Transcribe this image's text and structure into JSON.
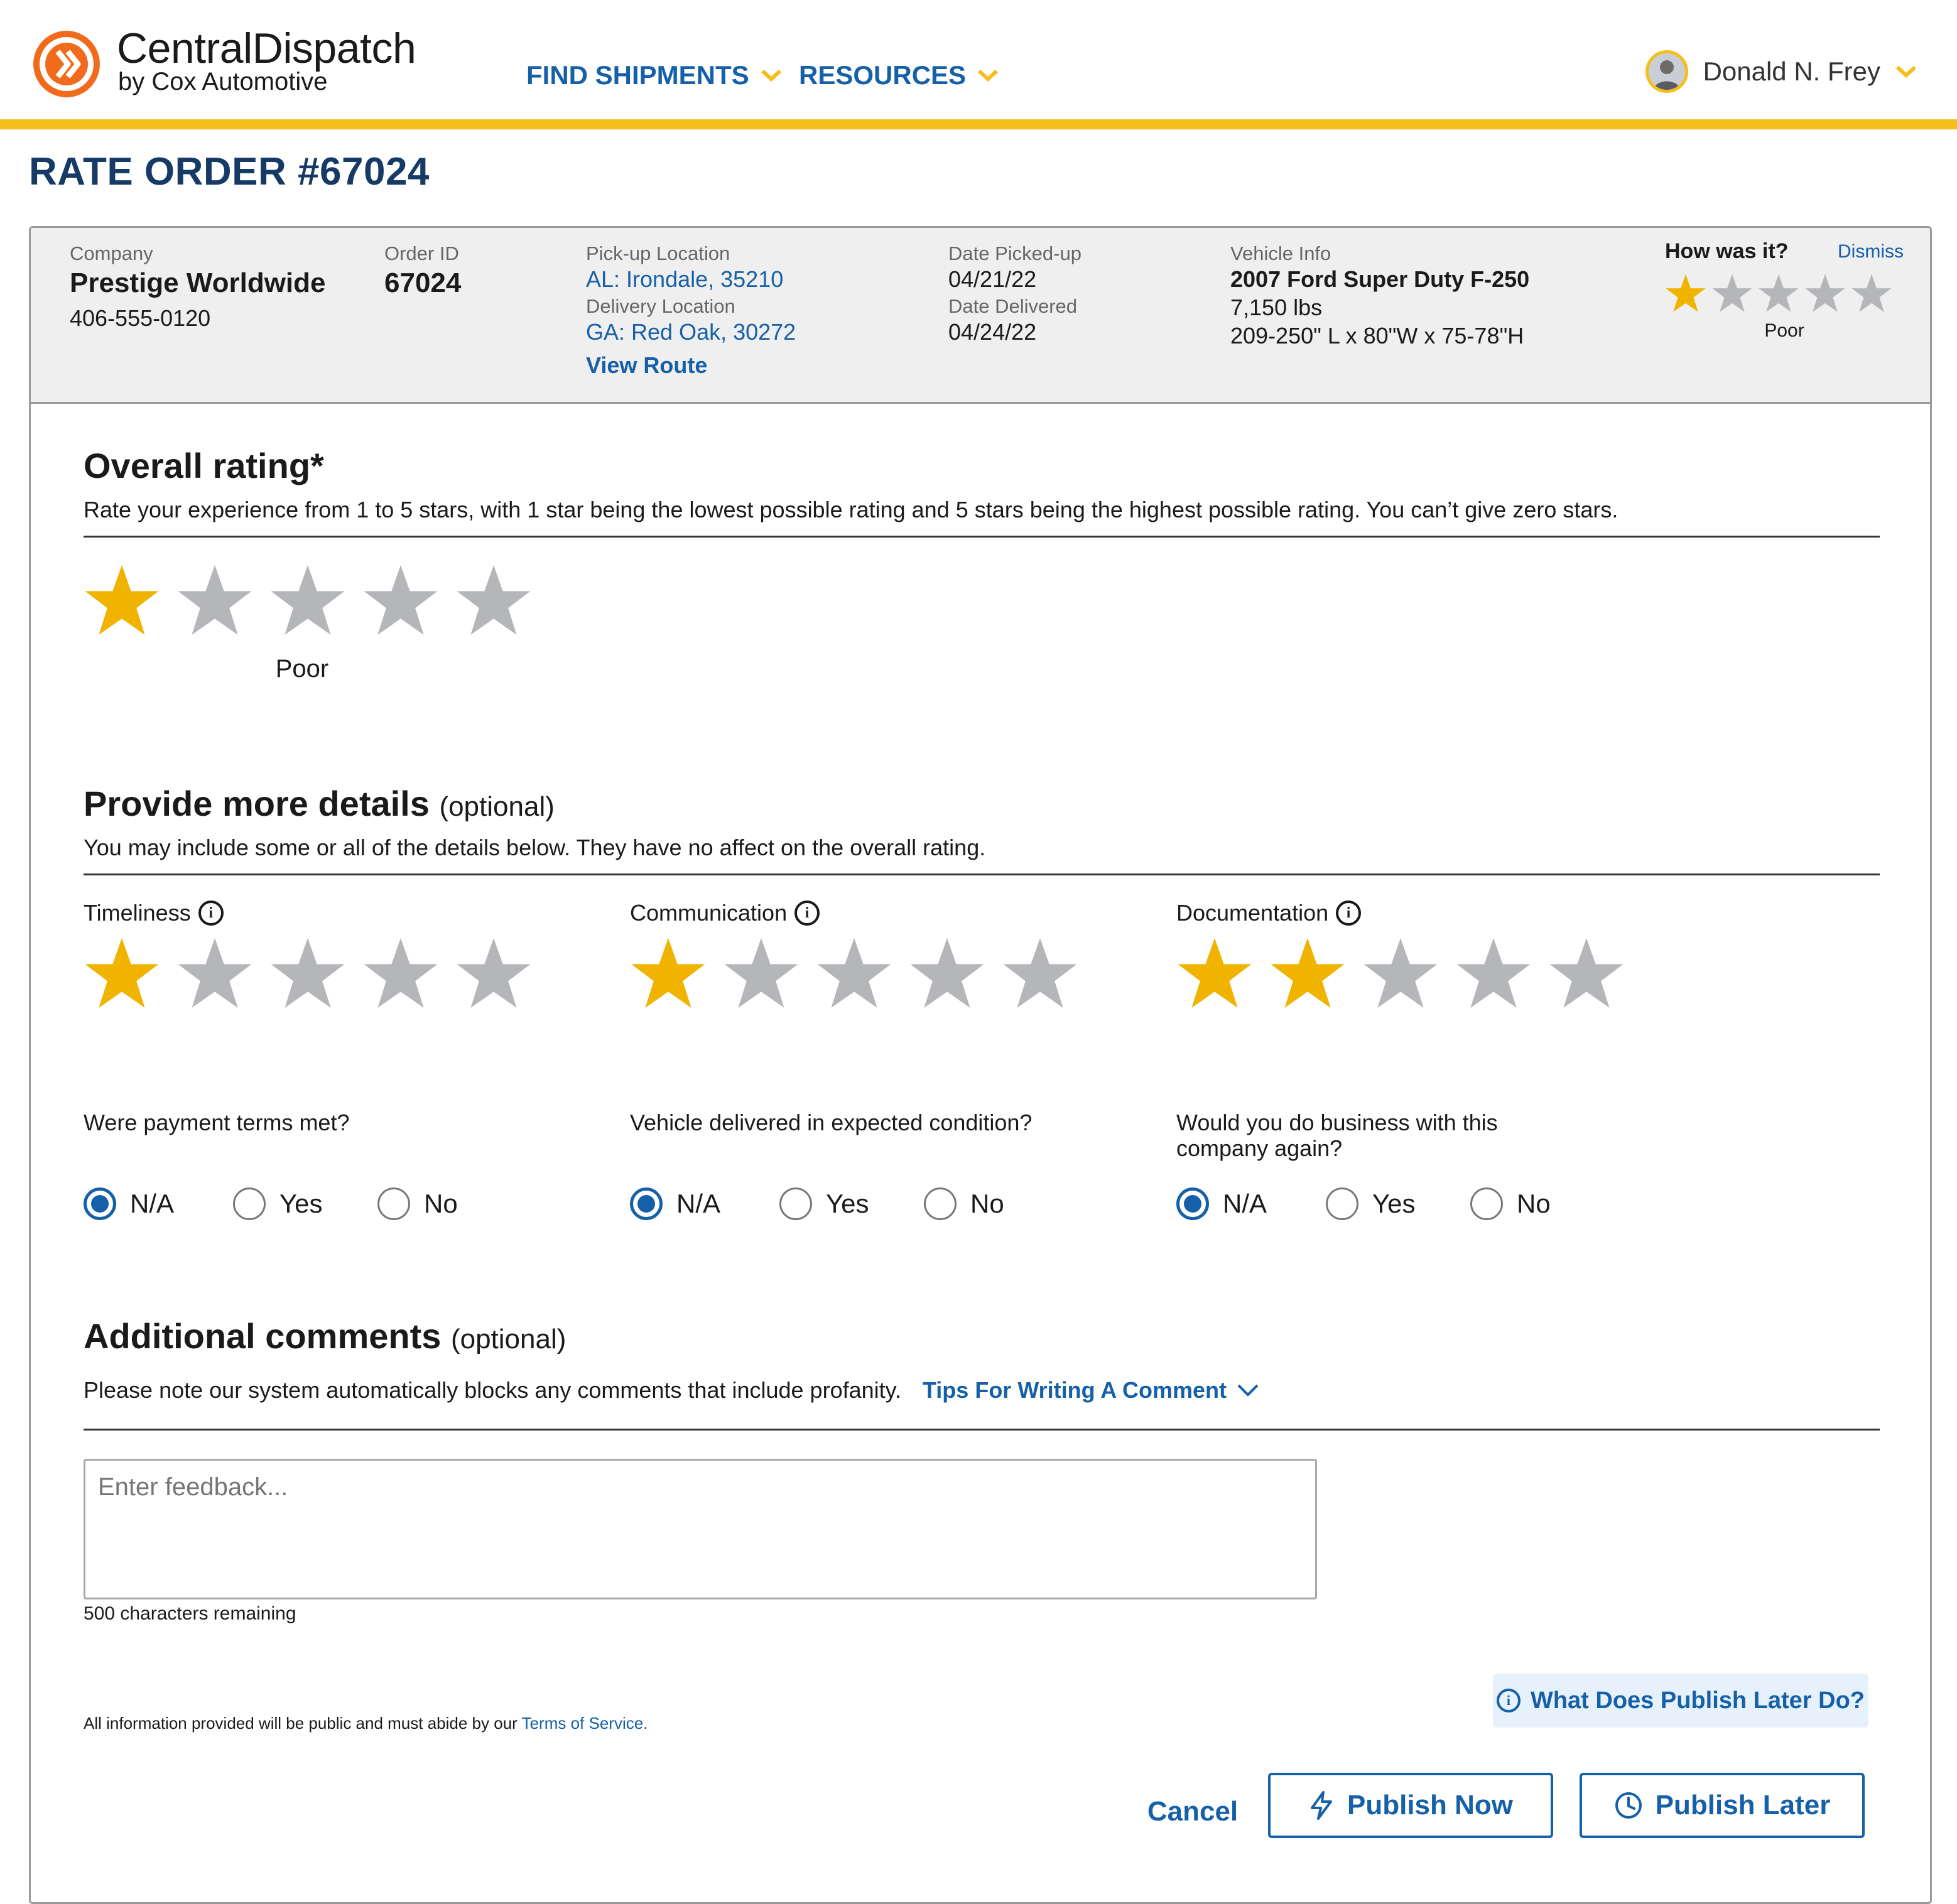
{
  "colors": {
    "accent_yellow": "#f6be1a",
    "link_blue": "#1560a8",
    "title_navy": "#163a66",
    "star_filled": "#f0b400",
    "star_empty": "#b5b6b9",
    "logo_orange": "#f26a1b"
  },
  "header": {
    "brand_name": "CentralDispatch",
    "brand_sub": "by Cox Automotive",
    "logo_icon": "chevron-logo-icon",
    "nav": [
      {
        "label": "FIND SHIPMENTS",
        "icon": "chevron-down-icon"
      },
      {
        "label": "RESOURCES",
        "icon": "chevron-down-icon"
      }
    ],
    "user_name": "Donald N. Frey",
    "user_icon": "chevron-down-icon"
  },
  "page_title": "RATE ORDER #67024",
  "summary": {
    "company_label": "Company",
    "company_name": "Prestige Worldwide",
    "company_phone": "406-555-0120",
    "order_id_label": "Order ID",
    "order_id": "67024",
    "pickup_label": "Pick-up Location",
    "pickup_value": "AL: Irondale, 35210",
    "delivery_label": "Delivery Location",
    "delivery_value": "GA: Red Oak, 30272",
    "view_route": "View Route",
    "picked_label": "Date Picked-up",
    "picked_value": "04/21/22",
    "delivered_label": "Date Delivered",
    "delivered_value": "04/24/22",
    "vehicle_label": "Vehicle Info",
    "vehicle_name": "2007 Ford Super Duty F-250",
    "vehicle_weight": "7,150 lbs",
    "vehicle_dims": "209-250\" L x 80\"W x 75-78\"H",
    "how_label": "How was it?",
    "dismiss": "Dismiss",
    "mini_rating": 1,
    "mini_rating_label": "Poor"
  },
  "overall": {
    "title": "Overall rating*",
    "description": "Rate your experience from 1 to 5 stars, with 1 star being the lowest possible rating and 5 stars being the highest possible rating. You can’t give zero stars.",
    "rating": 1,
    "max": 5,
    "rating_label": "Poor"
  },
  "details": {
    "title": "Provide more details",
    "optional": "(optional)",
    "description": "You may include some or all of the details below. They have no affect on the overall rating.",
    "categories": [
      {
        "label": "Timeliness",
        "rating": 1
      },
      {
        "label": "Communication",
        "rating": 1
      },
      {
        "label": "Documentation",
        "rating": 2
      }
    ],
    "questions": [
      {
        "text": "Were payment terms met?",
        "options": [
          "N/A",
          "Yes",
          "No"
        ],
        "selected": "N/A"
      },
      {
        "text": "Vehicle delivered in expected condition?",
        "options": [
          "N/A",
          "Yes",
          "No"
        ],
        "selected": "N/A"
      },
      {
        "text": "Would you do business with this company again?",
        "options": [
          "N/A",
          "Yes",
          "No"
        ],
        "selected": "N/A"
      }
    ]
  },
  "comments": {
    "title": "Additional comments",
    "optional": "(optional)",
    "note": "Please note our system automatically blocks any comments that include profanity.",
    "tips_link": "Tips For Writing A Comment",
    "placeholder": "Enter feedback...",
    "remaining": "500 characters remaining"
  },
  "footer": {
    "terms_prefix": "All information provided will be public and must abide by our",
    "terms_link": "Terms of Service.",
    "publish_later_help": "What Does Publish Later Do?",
    "cancel": "Cancel",
    "publish_now": "Publish Now",
    "publish_later": "Publish Later"
  }
}
